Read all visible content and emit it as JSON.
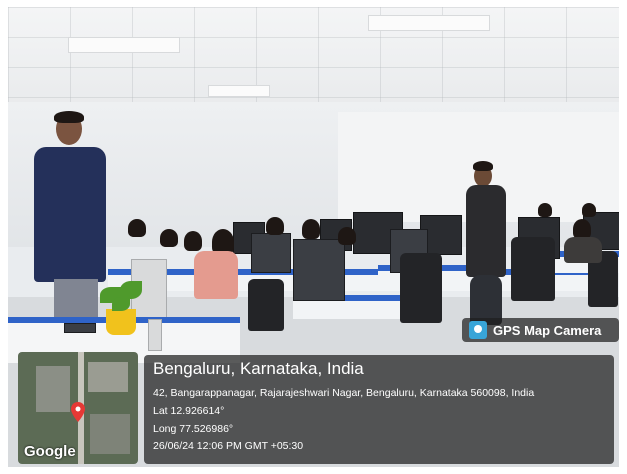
{
  "location": {
    "title": "Bengaluru, Karnataka, India",
    "address": "42, Bangarappanagar, Rajarajeshwari Nagar, Bengaluru, Karnataka 560098, India",
    "latitude": "Lat 12.926614°",
    "longitude": "Long 77.526986°",
    "datetime": "26/06/24 12:06 PM GMT +05:30"
  },
  "badge": {
    "label": "GPS Map Camera",
    "icon": "gps-map-camera-icon"
  },
  "map": {
    "logo": "Google",
    "pin_icon": "map-pin-icon"
  },
  "colors": {
    "desk_accent": "#2f63c8",
    "overlay_bg": "rgba(30,30,30,0.72)",
    "pin": "#e53935"
  }
}
